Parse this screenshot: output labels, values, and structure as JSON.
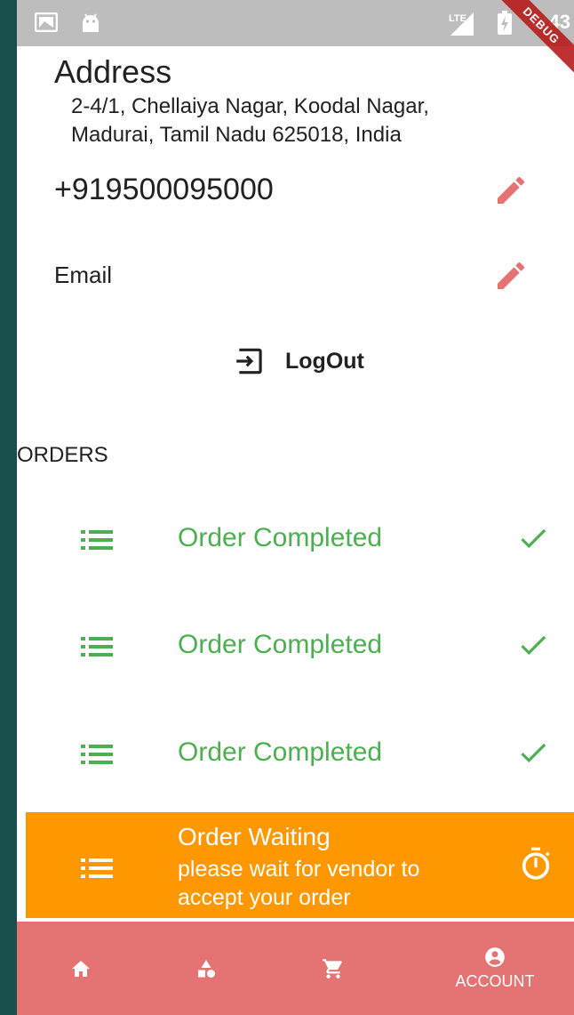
{
  "status_bar": {
    "time": "6:43",
    "network": "LTE",
    "debug_banner": "DEBUG"
  },
  "profile": {
    "address_title": "Address",
    "address_line1": "2-4/1, Chellaiya Nagar, Koodal Nagar,",
    "address_line2": "Madurai, Tamil Nadu 625018, India",
    "phone": "+919500095000",
    "email": "Email",
    "logout_label": "LogOut"
  },
  "orders": {
    "title": "ORDERS",
    "items": [
      {
        "status": "Order Completed",
        "state_icon": "check-icon"
      },
      {
        "status": "Order Completed",
        "state_icon": "check-icon"
      },
      {
        "status": "Order Completed",
        "state_icon": "check-icon"
      },
      {
        "status": "Order Waiting",
        "subtitle_line1": "please wait for vendor to",
        "subtitle_line2": "accept your order",
        "state_icon": "timer-icon"
      }
    ]
  },
  "bottom_nav": {
    "items": [
      {
        "icon": "home-icon",
        "label": ""
      },
      {
        "icon": "category-icon",
        "label": ""
      },
      {
        "icon": "cart-icon",
        "label": ""
      },
      {
        "icon": "account-icon",
        "label": "ACCOUNT"
      }
    ]
  },
  "colors": {
    "accent_red": "#e57373",
    "completed_green": "#4caf50",
    "waiting_orange": "#ff9800",
    "background_teal": "#17504c"
  }
}
